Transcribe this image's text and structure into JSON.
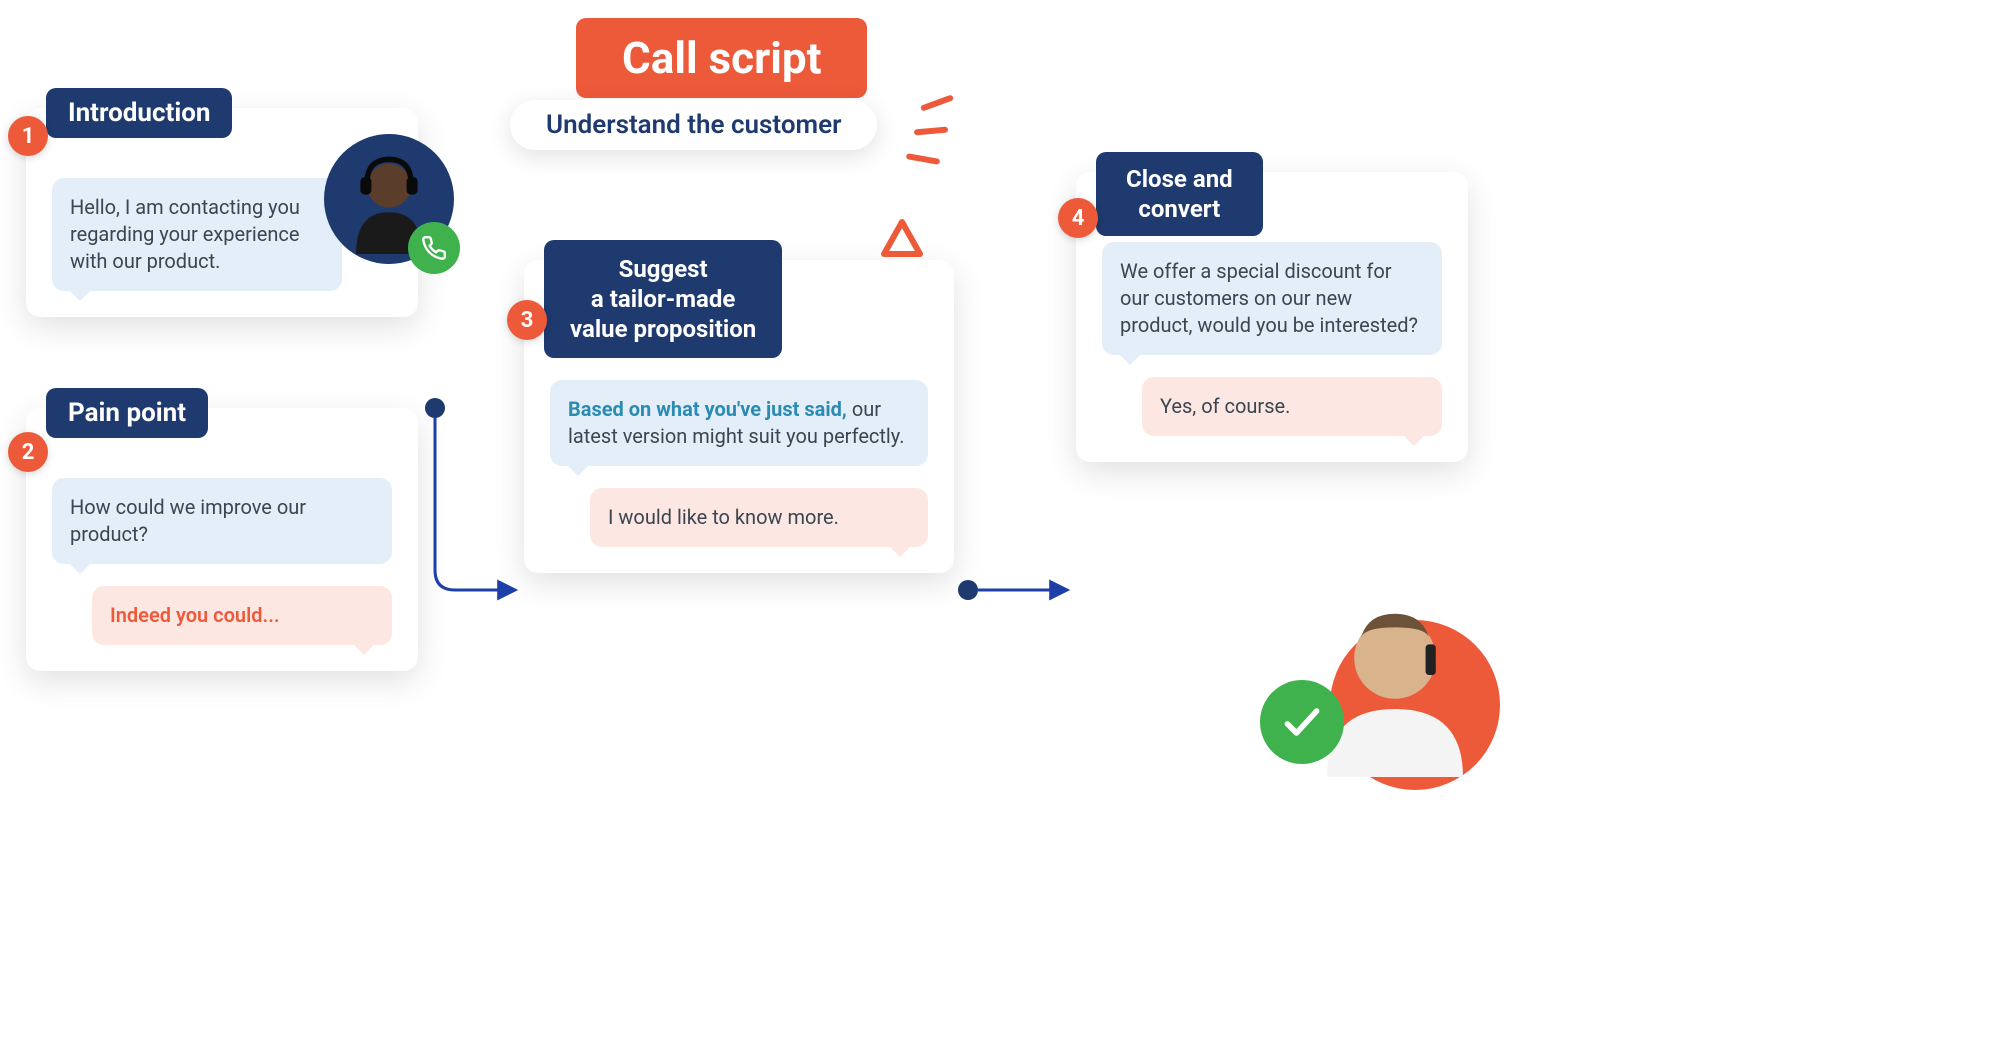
{
  "title": "Call script",
  "subtitle": "Understand the customer",
  "steps": [
    {
      "num": "1",
      "heading": "Introduction",
      "agent_text": "Hello, I am contacting you regarding your experience with our product."
    },
    {
      "num": "2",
      "heading": "Pain point",
      "agent_text": "How could we improve our product?",
      "customer_text": "Indeed you could..."
    },
    {
      "num": "3",
      "heading": "Suggest\na tailor-made\nvalue proposition",
      "agent_em": "Based on what you've just said,",
      "agent_rest": " our latest version might suit you perfectly.",
      "customer_text": "I would like to know more."
    },
    {
      "num": "4",
      "heading": "Close and\nconvert",
      "agent_text": "We offer a special discount for our customers on our new product, would you be interested?",
      "customer_text": "Yes, of course."
    }
  ],
  "icons": {
    "phone": "phone-icon",
    "check": "check-icon",
    "headset_avatar": "agent-avatar",
    "customer_avatar": "customer-avatar"
  }
}
